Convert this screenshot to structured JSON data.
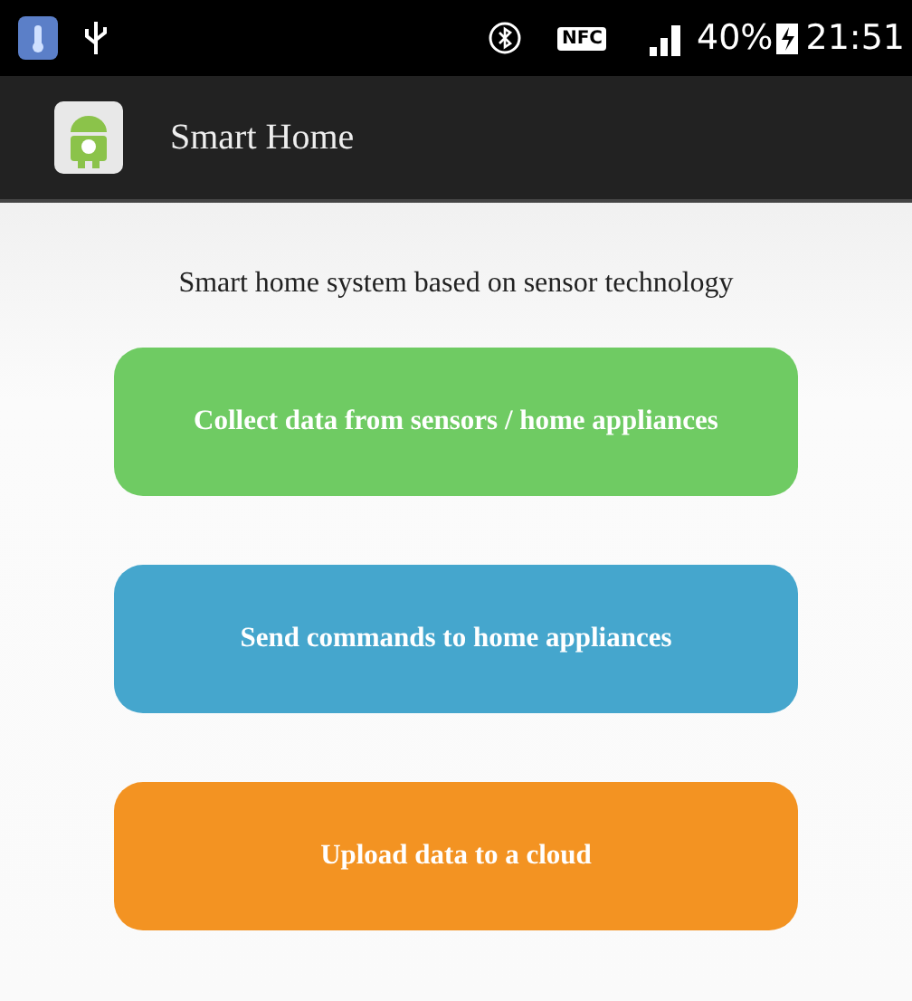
{
  "status_bar": {
    "nfc": "NFC",
    "battery": "40%",
    "time": "21:51"
  },
  "action_bar": {
    "title": "Smart Home"
  },
  "subtitle": "Smart home system based on sensor technology",
  "buttons": [
    {
      "label": "Collect data from sensors / home appliances",
      "color": "#6fcb63"
    },
    {
      "label": "Send commands to home appliances",
      "color": "#45a6cd"
    },
    {
      "label": "Upload data to a cloud",
      "color": "#f39322"
    }
  ]
}
